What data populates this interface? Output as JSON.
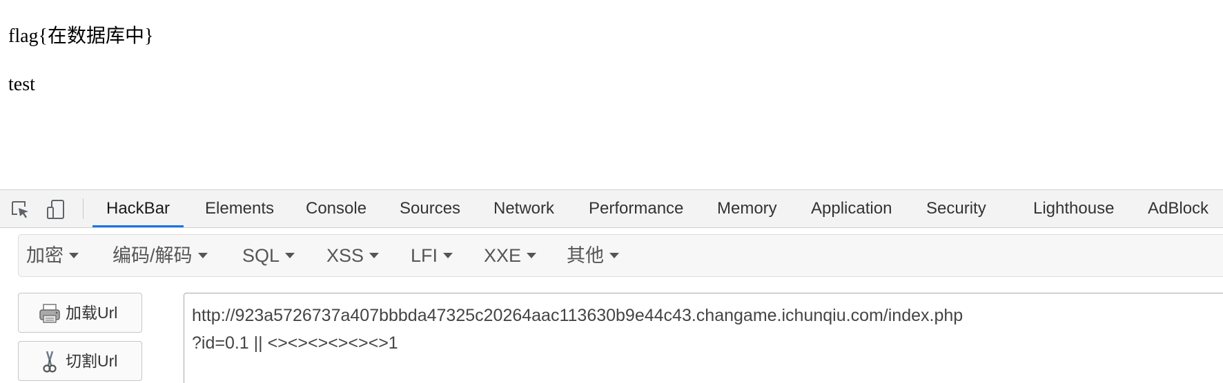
{
  "page": {
    "line1": "flag{在数据库中}",
    "line2": "test"
  },
  "devtools": {
    "tabs": [
      {
        "label": "HackBar",
        "active": true
      },
      {
        "label": "Elements"
      },
      {
        "label": "Console"
      },
      {
        "label": "Sources"
      },
      {
        "label": "Network"
      },
      {
        "label": "Performance"
      },
      {
        "label": "Memory"
      },
      {
        "label": "Application"
      },
      {
        "label": "Security"
      },
      {
        "label": "Lighthouse"
      },
      {
        "label": "AdBlock"
      }
    ],
    "icons": {
      "inspect": "inspect-element-icon",
      "device": "device-toolbar-icon"
    },
    "accent_color": "#1a73e8"
  },
  "hackbar": {
    "menu": [
      "加密",
      "编码/解码",
      "SQL",
      "XSS",
      "LFI",
      "XXE",
      "其他"
    ],
    "load_url_label": "加载Url",
    "split_url_label": "切割Url",
    "url_line1": "http://923a5726737a407bbbda47325c20264aac113630b9e44c43.changame.ichunqiu.com/index.php",
    "url_line2": "?id=0.1 || <><><><><><>1"
  }
}
